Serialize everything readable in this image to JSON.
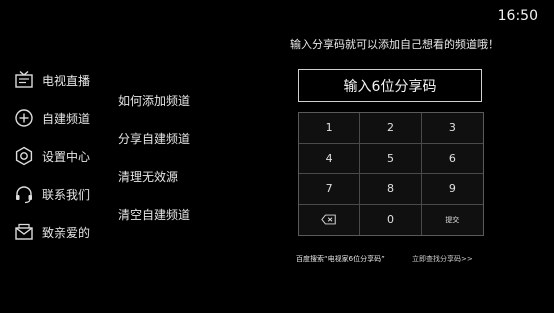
{
  "status": {
    "time": "16:50"
  },
  "sidebar": {
    "items": [
      {
        "label": "电视直播",
        "icon": "tv-icon"
      },
      {
        "label": "自建频道",
        "icon": "add-circle-icon"
      },
      {
        "label": "设置中心",
        "icon": "gear-icon"
      },
      {
        "label": "联系我们",
        "icon": "headset-icon"
      },
      {
        "label": "致亲爱的",
        "icon": "envelope-icon"
      }
    ]
  },
  "submenu": {
    "items": [
      "如何添加频道",
      "分享自建频道",
      "清理无效源",
      "清空自建频道"
    ]
  },
  "main": {
    "hint": "输入分享码就可以添加自己想看的频道哦！",
    "code_placeholder": "输入6位分享码",
    "keys": [
      "1",
      "2",
      "3",
      "4",
      "5",
      "6",
      "7",
      "8",
      "9",
      "⌫",
      "0",
      "提交"
    ],
    "footer_search": "百度搜索“电视家6位分享码”",
    "footer_link": "立即查找分享码>>"
  }
}
